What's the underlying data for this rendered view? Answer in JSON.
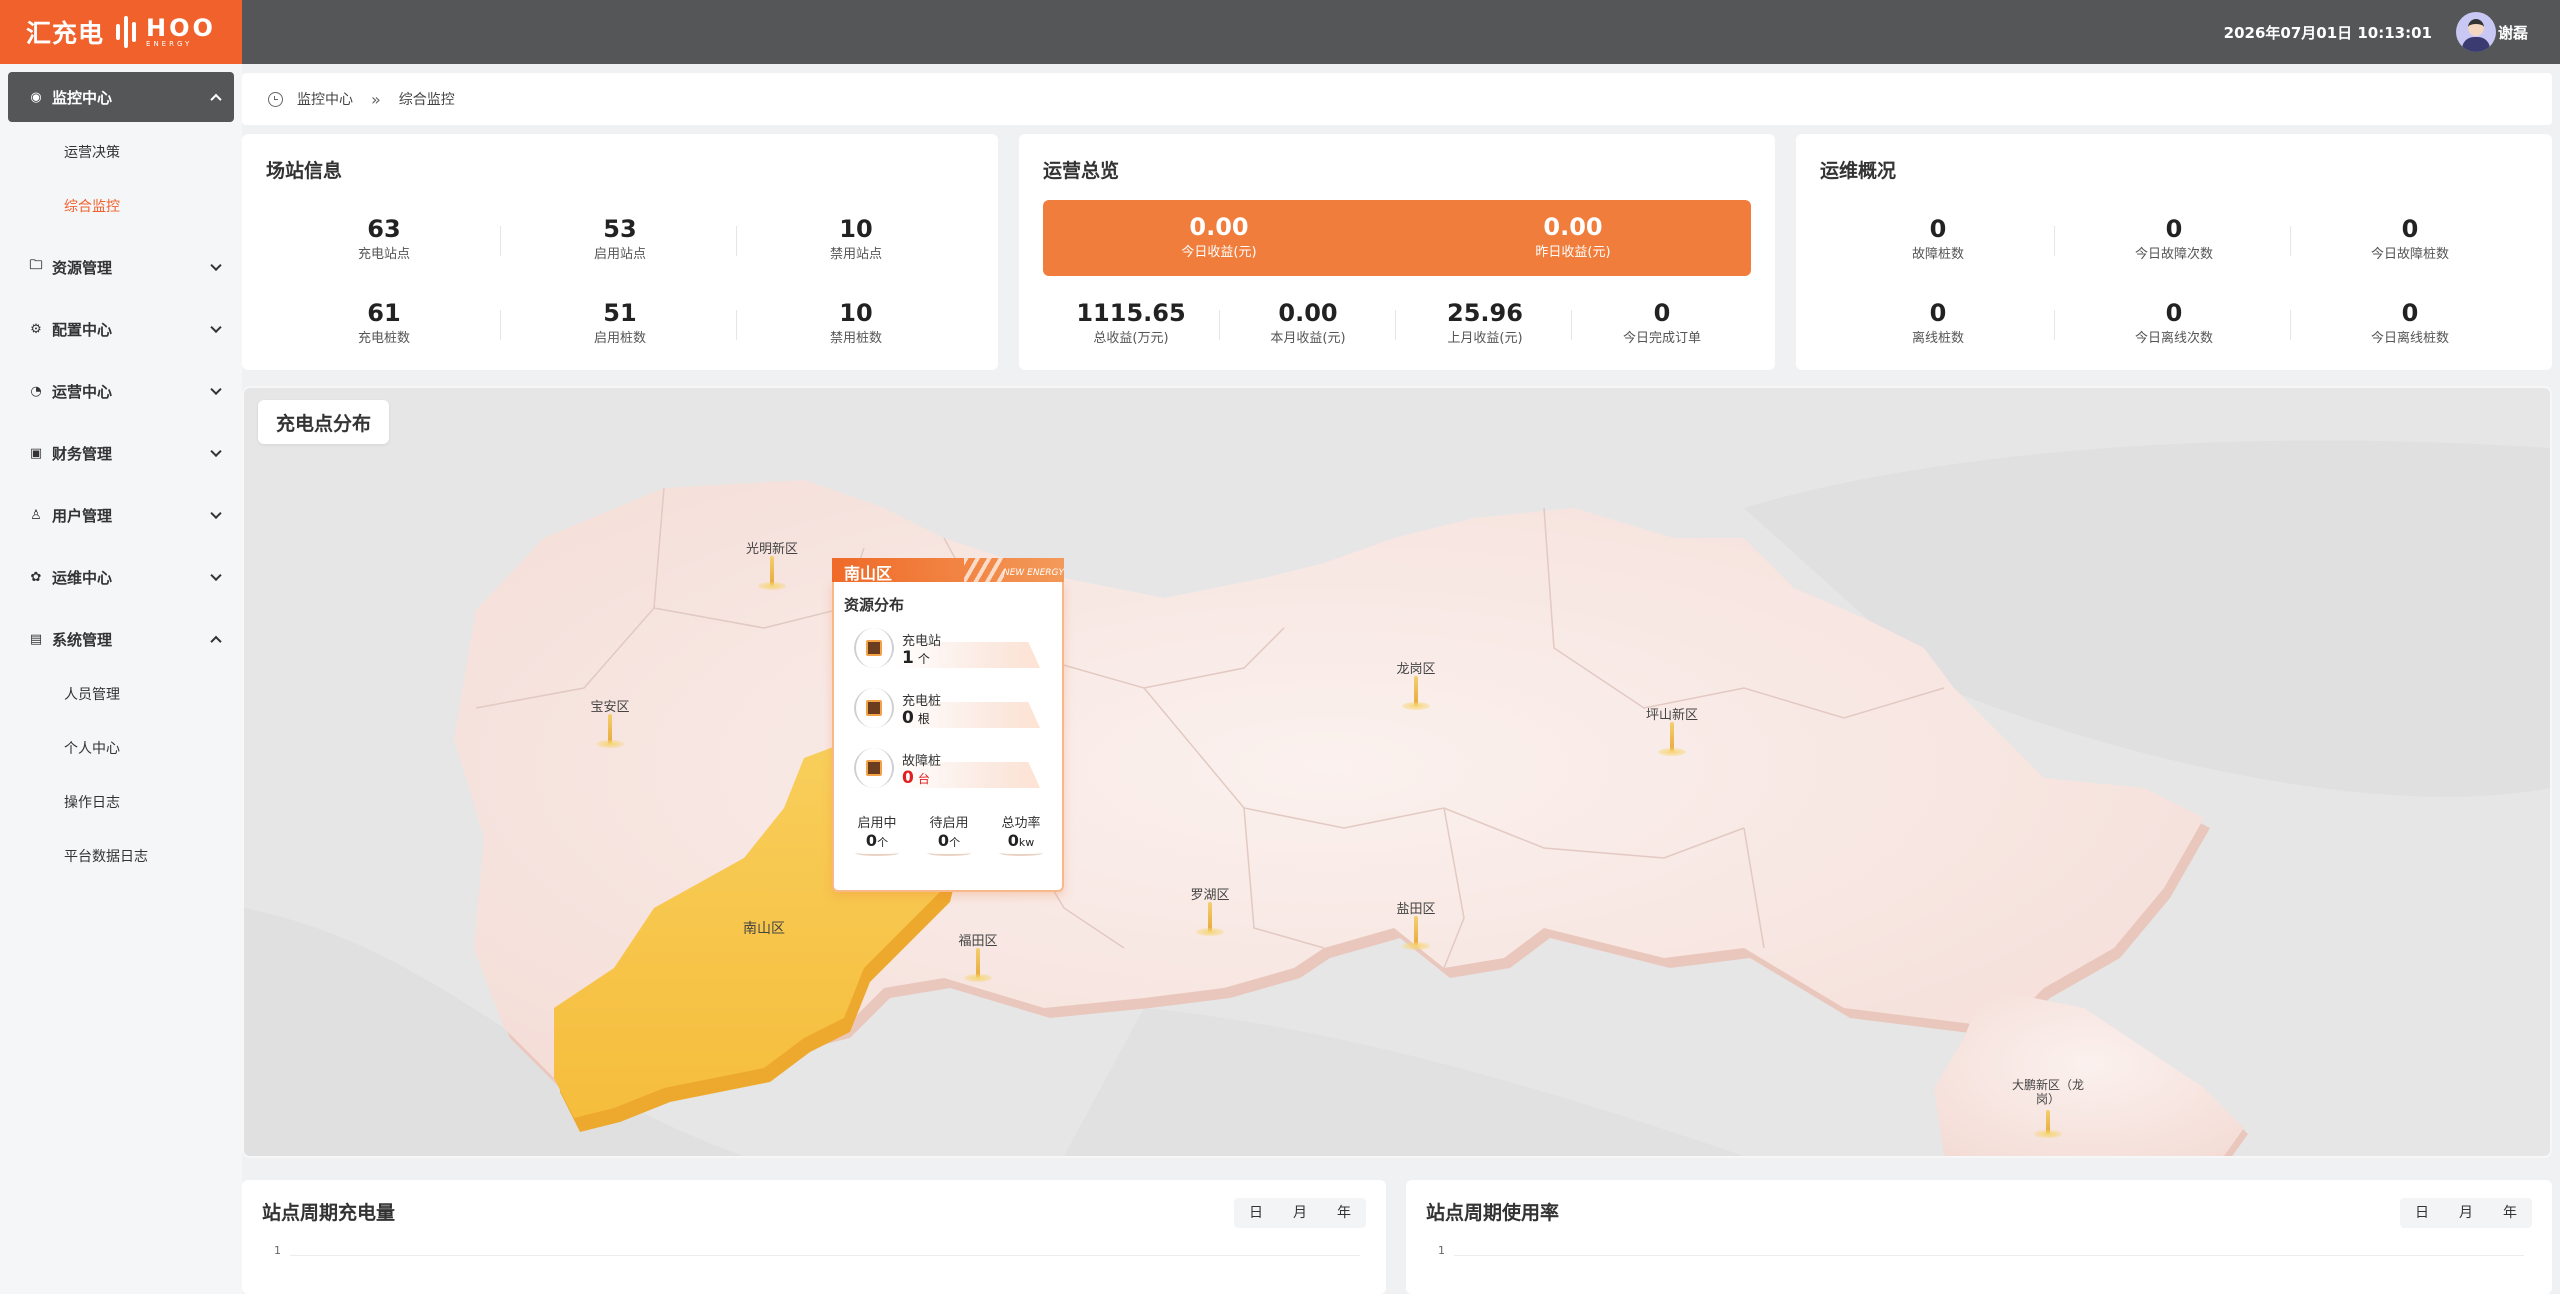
{
  "header": {
    "logo_cn": "汇充电",
    "logo_en": "HOO",
    "logo_sub": "ENERGY",
    "datetime": "2026年07月01日 10:13:01",
    "username": "谢磊"
  },
  "sidebar": {
    "menus": [
      {
        "label": "监控中心",
        "icon": "monitor-icon",
        "expanded": true,
        "active": true
      },
      {
        "label": "资源管理",
        "icon": "folder-icon"
      },
      {
        "label": "配置中心",
        "icon": "settings-icon"
      },
      {
        "label": "运营中心",
        "icon": "pie-chart-icon"
      },
      {
        "label": "财务管理",
        "icon": "finance-icon"
      },
      {
        "label": "用户管理",
        "icon": "user-icon"
      },
      {
        "label": "运维中心",
        "icon": "maintenance-icon"
      },
      {
        "label": "系统管理",
        "icon": "system-icon",
        "expanded": true
      }
    ],
    "monitor_subs": [
      "运营决策",
      "综合监控"
    ],
    "system_subs": [
      "人员管理",
      "个人中心",
      "操作日志",
      "平台数据日志"
    ]
  },
  "breadcrumb": {
    "root": "监控中心",
    "sep": "»",
    "current": "综合监控"
  },
  "station_info": {
    "title": "场站信息",
    "stats": [
      {
        "value": "63",
        "label": "充电站点"
      },
      {
        "value": "53",
        "label": "启用站点"
      },
      {
        "value": "10",
        "label": "禁用站点"
      },
      {
        "value": "61",
        "label": "充电桩数"
      },
      {
        "value": "51",
        "label": "启用桩数"
      },
      {
        "value": "10",
        "label": "禁用桩数"
      }
    ]
  },
  "operations": {
    "title": "运营总览",
    "highlight": [
      {
        "value": "0.00",
        "label": "今日收益(元)"
      },
      {
        "value": "0.00",
        "label": "昨日收益(元)"
      }
    ],
    "stats": [
      {
        "value": "1115.65",
        "label": "总收益(万元)"
      },
      {
        "value": "0.00",
        "label": "本月收益(元)"
      },
      {
        "value": "25.96",
        "label": "上月收益(元)"
      },
      {
        "value": "0",
        "label": "今日完成订单"
      }
    ]
  },
  "maintenance": {
    "title": "运维概况",
    "stats": [
      {
        "value": "0",
        "label": "故障桩数"
      },
      {
        "value": "0",
        "label": "今日故障次数"
      },
      {
        "value": "0",
        "label": "今日故障桩数"
      },
      {
        "value": "0",
        "label": "离线桩数"
      },
      {
        "value": "0",
        "label": "今日离线次数"
      },
      {
        "value": "0",
        "label": "今日离线桩数"
      }
    ]
  },
  "map": {
    "title": "充电点分布",
    "highlight_color": "#f7c54a",
    "districts": [
      {
        "name": "光明新区"
      },
      {
        "name": "宝安区"
      },
      {
        "name": "龙岗区"
      },
      {
        "name": "坪山新区"
      },
      {
        "name": "罗湖区"
      },
      {
        "name": "盐田区"
      },
      {
        "name": "福田区"
      },
      {
        "name": "大鹏新区（龙岗）"
      },
      {
        "name": "南山区"
      }
    ],
    "popup": {
      "district": "南山区",
      "tag": "NEW ENERGY",
      "subtitle": "资源分布",
      "rows": [
        {
          "label": "充电站",
          "value": "1",
          "unit": "个",
          "icon": "charging-station-icon"
        },
        {
          "label": "充电桩",
          "value": "0",
          "unit": "根",
          "icon": "charging-pile-icon"
        },
        {
          "label": "故障桩",
          "value": "0",
          "unit": "台",
          "icon": "fault-pile-icon"
        }
      ],
      "stats": [
        {
          "label": "启用中",
          "value": "0",
          "unit": "个"
        },
        {
          "label": "待启用",
          "value": "0",
          "unit": "个"
        },
        {
          "label": "总功率",
          "value": "0",
          "unit": "kw"
        }
      ]
    }
  },
  "charge_chart": {
    "title": "站点周期充电量",
    "periods": [
      "日",
      "月",
      "年"
    ],
    "ytick": "1"
  },
  "usage_chart": {
    "title": "站点周期使用率",
    "periods": [
      "日",
      "月",
      "年"
    ],
    "ytick": "1"
  }
}
